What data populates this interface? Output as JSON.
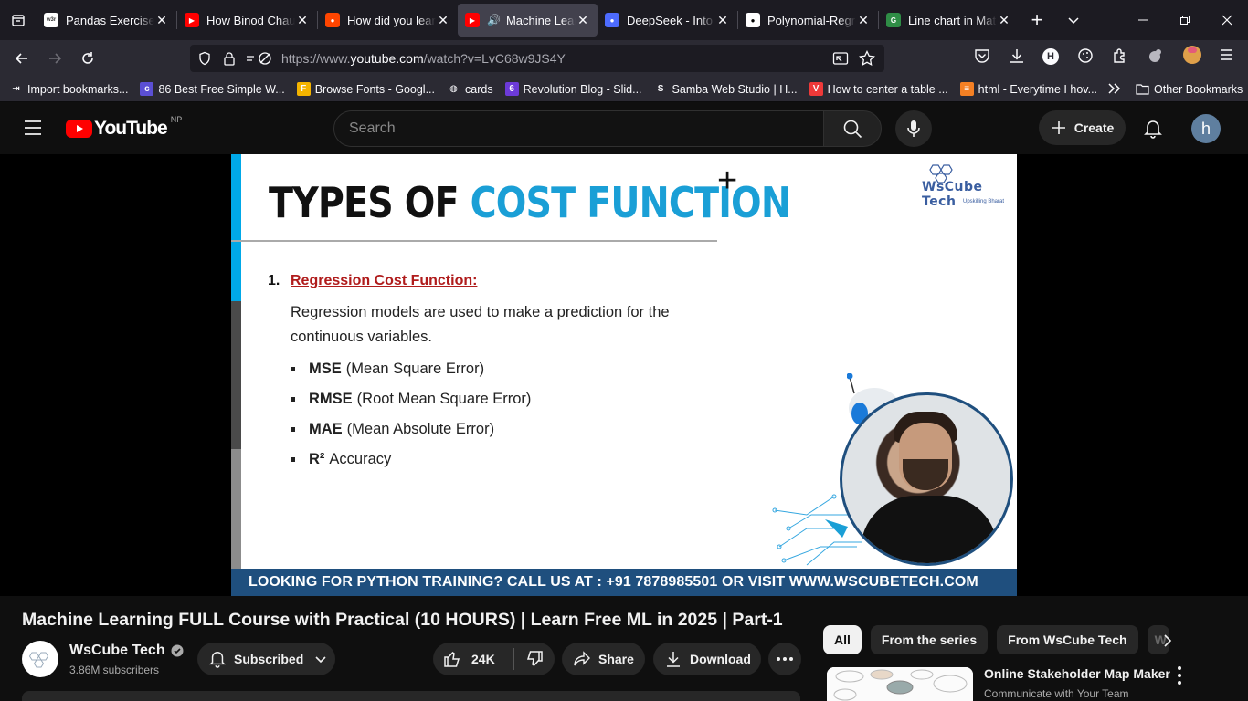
{
  "browser": {
    "tabs": [
      {
        "title": "Pandas Exercises, P",
        "favicon": "w3r",
        "fav_color": "#ffffff",
        "fav_text": "#333333",
        "active": false
      },
      {
        "title": "How Binod Chaudh",
        "favicon": "youtube-icon",
        "fav_color": "#ff0000",
        "fav_text": "#ffffff",
        "active": false
      },
      {
        "title": "How did you learn",
        "favicon": "reddit-icon",
        "fav_color": "#ff4500",
        "fav_text": "#ffffff",
        "active": false
      },
      {
        "title": "Machine Learn",
        "favicon": "youtube-icon",
        "fav_color": "#ff0000",
        "fav_text": "#ffffff",
        "active": true
      },
      {
        "title": "DeepSeek - Into th",
        "favicon": "deepseek-icon",
        "fav_color": "#4d6bfe",
        "fav_text": "#ffffff",
        "active": false
      },
      {
        "title": "Polynomial-Regre",
        "favicon": "github-icon",
        "fav_color": "#ffffff",
        "fav_text": "#000000",
        "active": false
      },
      {
        "title": "Line chart in Matp",
        "favicon": "gfg-icon",
        "fav_color": "#2f8d46",
        "fav_text": "#ffffff",
        "active": false
      }
    ],
    "url_prefix": "https://www.",
    "url_domain": "youtube.com",
    "url_path": "/watch?v=LvC68w9JS4Y",
    "bookmarks": [
      {
        "label": "Import bookmarks...",
        "icon": "import-icon"
      },
      {
        "label": "86 Best Free Simple W...",
        "icon": "colorlib-icon"
      },
      {
        "label": "Browse Fonts - Googl...",
        "icon": "google-fonts-icon"
      },
      {
        "label": "cards",
        "icon": "globe-icon"
      },
      {
        "label": "Revolution Blog - Slid...",
        "icon": "revolution-icon"
      },
      {
        "label": "Samba Web Studio | H...",
        "icon": "samba-icon"
      },
      {
        "label": "How to center a table ...",
        "icon": "vivaldi-icon"
      },
      {
        "label": "html - Everytime I hov...",
        "icon": "stackoverflow-icon"
      }
    ],
    "other_bookmarks": "Other Bookmarks"
  },
  "youtube": {
    "logo_text": "YouTube",
    "country_code": "NP",
    "search_placeholder": "Search",
    "create_label": "Create",
    "avatar_letter": "h"
  },
  "slide": {
    "title_part1": "TYPES OF ",
    "title_part2": "COST FUNCTION",
    "brand_name": "WsCube Tech",
    "brand_tagline": "Upskilling Bharat",
    "number": "1.",
    "heading": "Regression Cost Function:",
    "paragraph": "Regression models are used to make a prediction for the continuous variables.",
    "items": [
      {
        "bold": "MSE",
        "rest": "(Mean Square Error)"
      },
      {
        "bold": "RMSE",
        "rest": "(Root Mean Square Error)"
      },
      {
        "bold": "MAE",
        "rest": "(Mean Absolute Error)"
      },
      {
        "bold": "R²",
        "rest": "Accuracy"
      }
    ],
    "footer": "LOOKING FOR PYTHON TRAINING? CALL US AT : +91 7878985501 OR VISIT WWW.WSCUBETECH.COM"
  },
  "video": {
    "title": "Machine Learning FULL Course with Practical (10 HOURS) | Learn Free ML in 2025 | Part-1",
    "channel": "WsCube Tech",
    "subscribers": "3.86M subscribers",
    "subscribed_label": "Subscribed",
    "likes": "24K",
    "share_label": "Share",
    "download_label": "Download"
  },
  "sidebar": {
    "chips": [
      "All",
      "From the series",
      "From WsCube Tech",
      "W"
    ],
    "rec_title": "Online Stakeholder Map Maker",
    "rec_subtitle": "Communicate with Your Team"
  }
}
